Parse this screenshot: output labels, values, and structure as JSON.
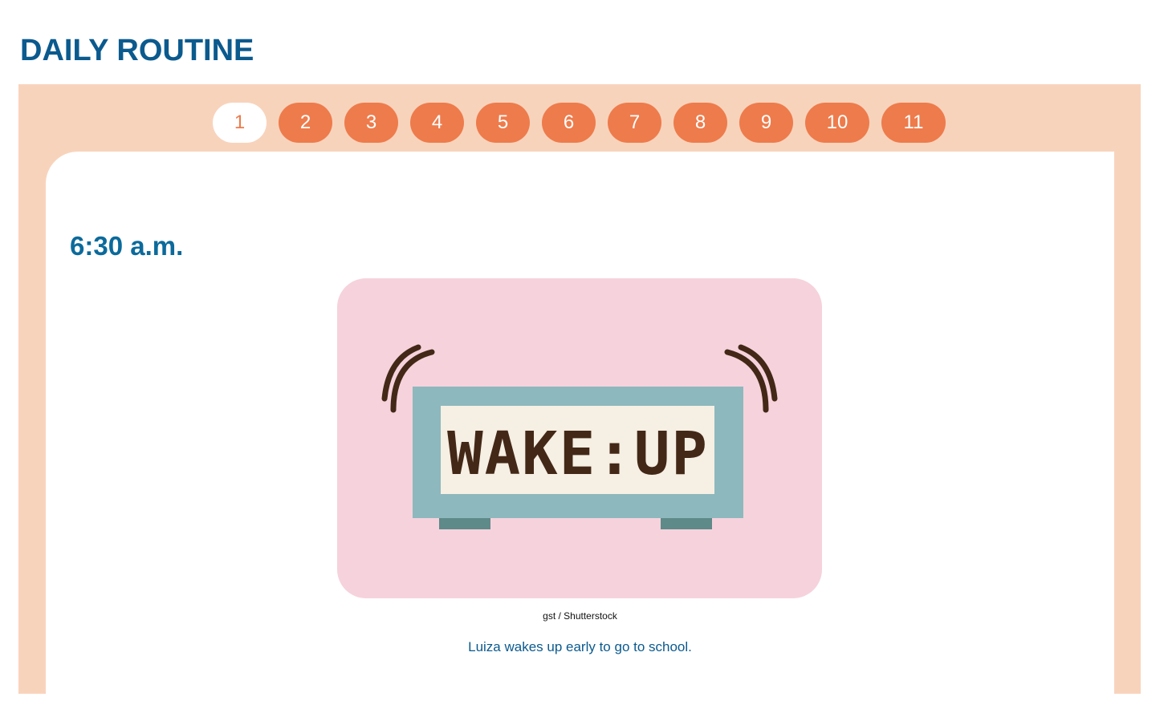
{
  "page": {
    "title": "DAILY ROUTINE"
  },
  "pager": {
    "pages": [
      "1",
      "2",
      "3",
      "4",
      "5",
      "6",
      "7",
      "8",
      "9",
      "10",
      "11"
    ],
    "current": "1"
  },
  "slide": {
    "time": "6:30 a.m.",
    "illustration": {
      "display_text": "WAKE:UP",
      "icon": "alarm-clock-icon",
      "colors": {
        "background": "#f6d2dc",
        "clock_body": "#8db8bd",
        "screen": "#f6efe3",
        "digits": "#432817",
        "feet": "#5e8a89"
      }
    },
    "credit": "gst / Shutterstock",
    "caption": "Luiza wakes up early to go to school."
  },
  "colors": {
    "title": "#0b5a8e",
    "frame": "#f8d3bc",
    "pager_button": "#ee7b4b",
    "pager_active_bg": "#ffffff"
  }
}
